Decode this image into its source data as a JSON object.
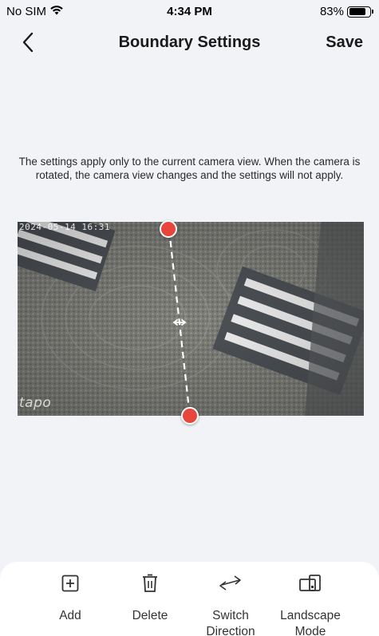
{
  "status_bar": {
    "carrier": "No SIM",
    "time": "4:34 PM",
    "battery": "83%",
    "battery_level": 0.83
  },
  "nav": {
    "title": "Boundary Settings",
    "save_label": "Save"
  },
  "info_text": "The settings apply only to the current camera view. When the camera is rotated, the camera view changes and the settings will not apply.",
  "camera": {
    "timestamp": "2024-05-14 16:31",
    "watermark": "tapo"
  },
  "toolbar": {
    "items": [
      {
        "label": "Add",
        "icon": "add-icon"
      },
      {
        "label": "Delete",
        "icon": "trash-icon"
      },
      {
        "label": "Switch Direction",
        "icon": "switch-direction-icon"
      },
      {
        "label": "Landscape Mode",
        "icon": "landscape-mode-icon"
      }
    ]
  },
  "colors": {
    "accent": "#e8453c",
    "background": "#f2f3f7",
    "toolbar_bg": "#ffffff"
  }
}
